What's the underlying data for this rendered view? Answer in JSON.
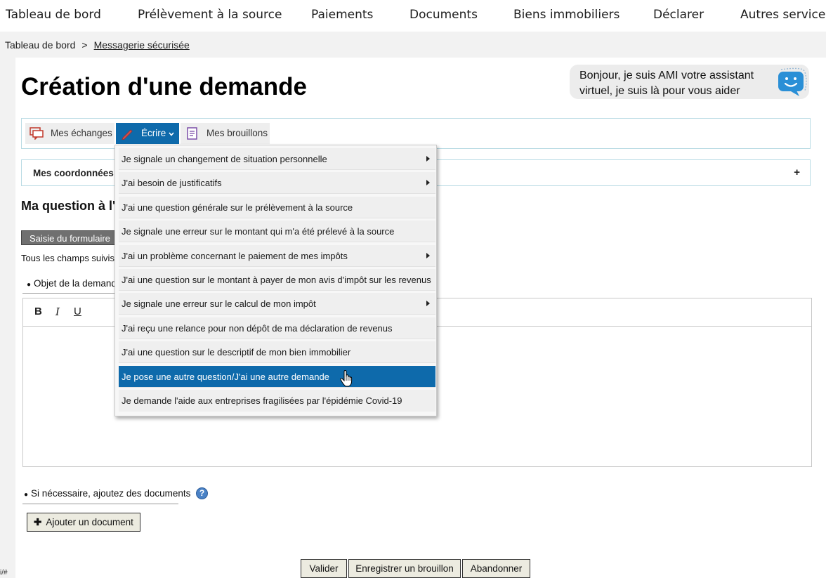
{
  "nav": {
    "items": [
      "Tableau de bord",
      "Prélèvement à la source",
      "Paiements",
      "Documents",
      "Biens immobiliers",
      "Déclarer",
      "Autres services"
    ]
  },
  "breadcrumb": {
    "home": "Tableau de bord",
    "separator": ">",
    "current": "Messagerie sécurisée"
  },
  "page": {
    "title": "Création d'une demande"
  },
  "assistant": {
    "text": "Bonjour, je suis AMI votre assistant virtuel, je suis là pour vous aider",
    "icon": "chat-bubble-smile-icon"
  },
  "tabs": [
    {
      "label": "Mes échanges",
      "icon": "messages-icon"
    },
    {
      "label": "Écrire",
      "icon": "pencil-icon",
      "active": true
    },
    {
      "label": "Mes brouillons",
      "icon": "draft-document-icon"
    }
  ],
  "coordinates": {
    "label": "Mes coordonnées",
    "toggle": "+"
  },
  "question": {
    "title": "Ma question à l'"
  },
  "form": {
    "step_label": "Saisie du formulaire",
    "required_note": "Tous les champs suivis",
    "subject_label": "Objet de la demand",
    "editor_buttons": [
      "B",
      "I",
      "U"
    ],
    "documents_label": "Si nécessaire, ajoutez des documents",
    "add_document": "Ajouter un document",
    "bullet": "●"
  },
  "actions": {
    "submit": "Valider",
    "save_draft": "Enregistrer un brouillon",
    "cancel": "Abandonner"
  },
  "status_bar": {
    "text": "i/#"
  },
  "dropdown": {
    "items": [
      {
        "label": "Je signale un changement de situation personnelle",
        "submenu": true
      },
      {
        "label": "J'ai besoin de justificatifs",
        "submenu": true
      },
      {
        "label": "J'ai une question générale sur le prélèvement à la source",
        "submenu": false
      },
      {
        "label": "Je signale une erreur sur le montant qui m'a été prélevé à la source",
        "submenu": false
      },
      {
        "label": "J'ai un problème concernant le paiement de mes impôts",
        "submenu": true
      },
      {
        "label": "J'ai une question sur le montant à payer de mon avis d'impôt sur les revenus",
        "submenu": false
      },
      {
        "label": "Je signale une erreur sur le calcul de mon impôt",
        "submenu": true
      },
      {
        "label": "J'ai reçu une relance pour non dépôt de ma déclaration de revenus",
        "submenu": false
      },
      {
        "label": "J'ai une question sur le descriptif de mon bien immobilier",
        "submenu": false
      },
      {
        "label": "Je pose une autre question/J'ai une autre demande",
        "submenu": false,
        "highlighted": true
      },
      {
        "label": "Je demande l'aide aux entreprises fragilisées par l'épidémie Covid-19",
        "submenu": false
      }
    ]
  },
  "colors": {
    "accent": "#0e6aab",
    "border_accent": "#b9dbe4"
  }
}
